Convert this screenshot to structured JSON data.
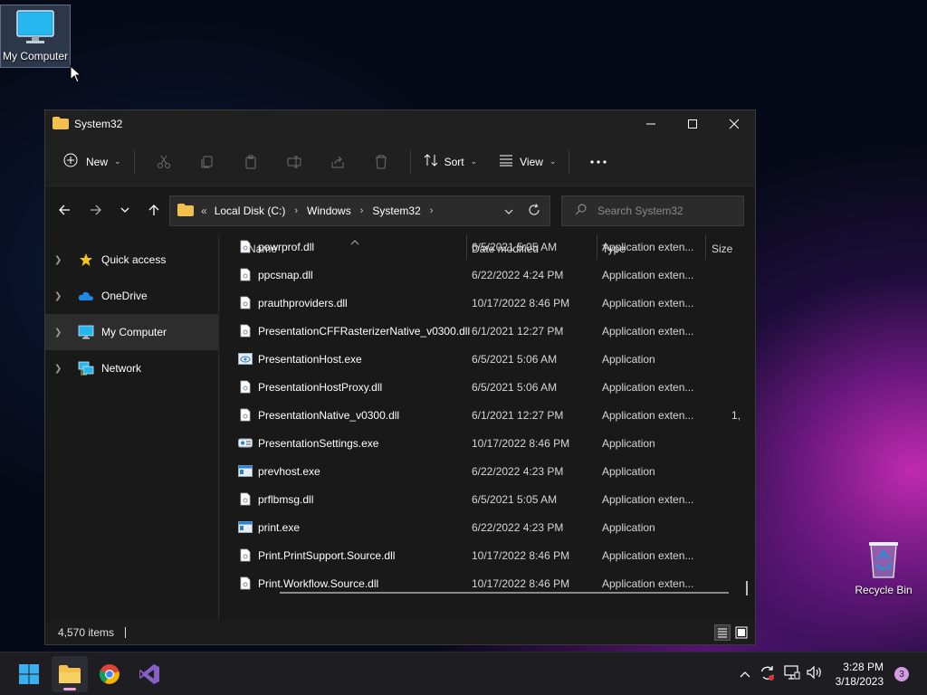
{
  "desktop": {
    "my_computer_label": "My Computer",
    "recycle_bin_label": "Recycle Bin"
  },
  "window": {
    "title": "System32",
    "toolbar": {
      "new_label": "New",
      "sort_label": "Sort",
      "view_label": "View"
    },
    "address": {
      "overflow": "«",
      "crumbs": [
        "Local Disk (C:)",
        "Windows",
        "System32"
      ]
    },
    "search": {
      "placeholder": "Search System32"
    },
    "sidebar": {
      "items": [
        {
          "label": "Quick access"
        },
        {
          "label": "OneDrive"
        },
        {
          "label": "My Computer"
        },
        {
          "label": "Network"
        }
      ]
    },
    "columns": {
      "name": "Name",
      "date": "Date modified",
      "type": "Type",
      "size": "Size"
    },
    "files": [
      {
        "name": "powrprof.dll",
        "date": "6/5/2021 5:05 AM",
        "type": "Application exten...",
        "size": "",
        "icon": "dll"
      },
      {
        "name": "ppcsnap.dll",
        "date": "6/22/2022 4:24 PM",
        "type": "Application exten...",
        "size": "",
        "icon": "dll"
      },
      {
        "name": "prauthproviders.dll",
        "date": "10/17/2022 8:46 PM",
        "type": "Application exten...",
        "size": "",
        "icon": "dll"
      },
      {
        "name": "PresentationCFFRasterizerNative_v0300.dll",
        "date": "6/1/2021 12:27 PM",
        "type": "Application exten...",
        "size": "",
        "icon": "dll"
      },
      {
        "name": "PresentationHost.exe",
        "date": "6/5/2021 5:06 AM",
        "type": "Application",
        "size": "",
        "icon": "exe-eye"
      },
      {
        "name": "PresentationHostProxy.dll",
        "date": "6/5/2021 5:06 AM",
        "type": "Application exten...",
        "size": "",
        "icon": "dll"
      },
      {
        "name": "PresentationNative_v0300.dll",
        "date": "6/1/2021 12:27 PM",
        "type": "Application exten...",
        "size": "1,",
        "icon": "dll"
      },
      {
        "name": "PresentationSettings.exe",
        "date": "10/17/2022 8:46 PM",
        "type": "Application",
        "size": "",
        "icon": "exe-settings"
      },
      {
        "name": "prevhost.exe",
        "date": "6/22/2022 4:23 PM",
        "type": "Application",
        "size": "",
        "icon": "exe"
      },
      {
        "name": "prflbmsg.dll",
        "date": "6/5/2021 5:05 AM",
        "type": "Application exten...",
        "size": "",
        "icon": "dll"
      },
      {
        "name": "print.exe",
        "date": "6/22/2022 4:23 PM",
        "type": "Application",
        "size": "",
        "icon": "exe"
      },
      {
        "name": "Print.PrintSupport.Source.dll",
        "date": "10/17/2022 8:46 PM",
        "type": "Application exten...",
        "size": "",
        "icon": "dll"
      },
      {
        "name": "Print.Workflow.Source.dll",
        "date": "10/17/2022 8:46 PM",
        "type": "Application exten...",
        "size": "",
        "icon": "dll"
      }
    ],
    "status": {
      "item_count": "4,570 items"
    }
  },
  "taskbar": {
    "time": "3:28 PM",
    "date": "3/18/2023",
    "notification_count": "3"
  }
}
